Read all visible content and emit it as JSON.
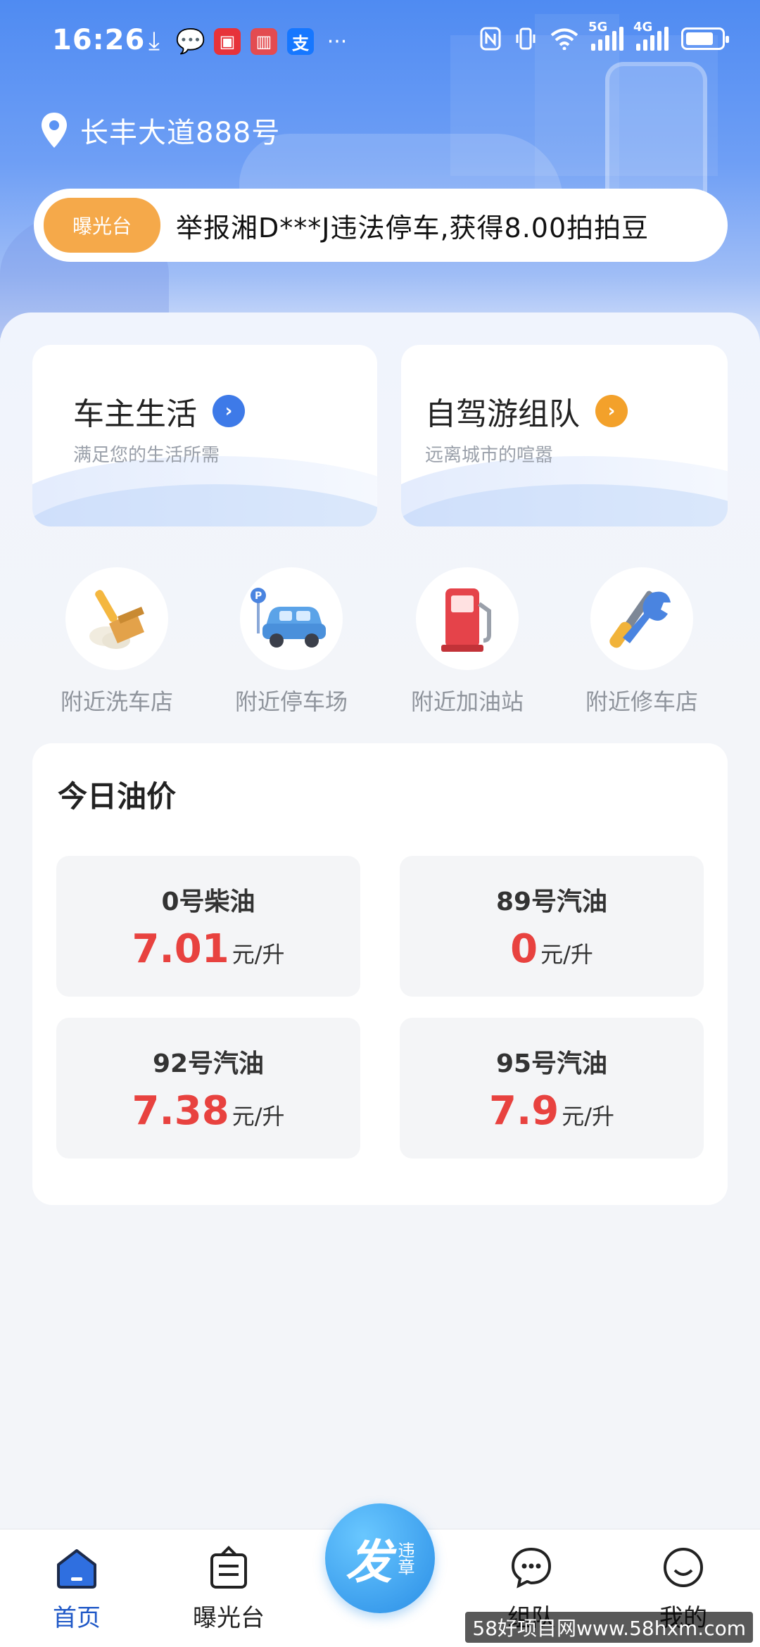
{
  "status_bar": {
    "time": "16:26",
    "app_icons": [
      "download-icon",
      "wechat-icon",
      "cloudpay-icon",
      "book-icon",
      "alipay-icon",
      "more-icon"
    ],
    "network_5g": "5G",
    "network_4g": "4G"
  },
  "header": {
    "address": "长丰大道888号",
    "ticker_badge": "曝光台",
    "ticker_text": "举报湘D***J违法停车,获得8.00拍拍豆"
  },
  "cards": [
    {
      "title": "车主生活",
      "subtitle": "满足您的生活所需",
      "accent": "#3e7ae8"
    },
    {
      "title": "自驾游组队",
      "subtitle": "远离城市的喧嚣",
      "accent": "#f3a12b"
    }
  ],
  "quick_links": [
    {
      "label": "附近洗车店",
      "icon": "car-wash-broom-icon"
    },
    {
      "label": "附近停车场",
      "icon": "parking-car-icon"
    },
    {
      "label": "附近加油站",
      "icon": "gas-pump-icon"
    },
    {
      "label": "附近修车店",
      "icon": "repair-tools-icon"
    }
  ],
  "oil_prices": {
    "title": "今日油价",
    "items": [
      {
        "name": "0号柴油",
        "price": "7.01",
        "unit": "元/升"
      },
      {
        "name": "89号汽油",
        "price": "0",
        "unit": "元/升"
      },
      {
        "name": "92号汽油",
        "price": "7.38",
        "unit": "元/升"
      },
      {
        "name": "95号汽油",
        "price": "7.9",
        "unit": "元/升"
      }
    ],
    "price_color": "#e8423f"
  },
  "tabbar": {
    "home": "首页",
    "exposure": "曝光台",
    "fab_big": "发",
    "fab_small": "违章",
    "team": "组队",
    "mine": "我的",
    "active_color": "#1f58c7"
  },
  "watermark": "58好项目网www.58hxm.com"
}
